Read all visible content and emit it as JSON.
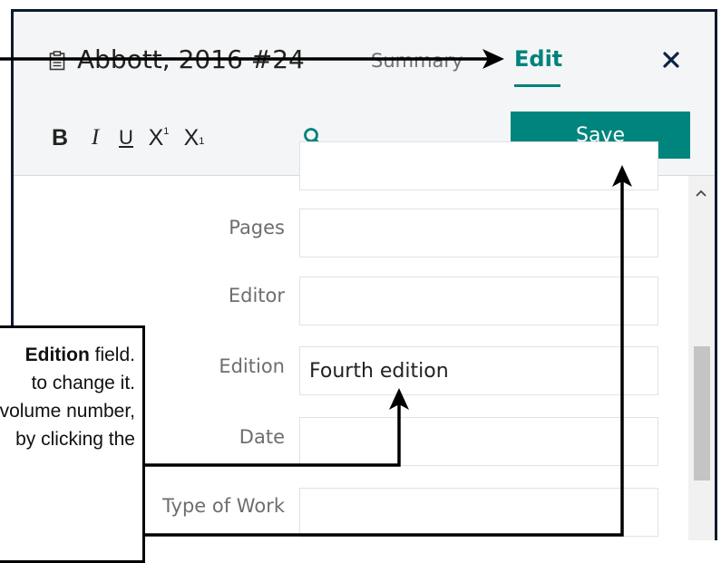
{
  "reference": {
    "icon": "clipboard-icon",
    "title": "Abbott, 2016 #24"
  },
  "tabs": [
    {
      "label": "Summary",
      "active": false
    },
    {
      "label": "Edit",
      "active": true
    }
  ],
  "close_icon": "close-icon",
  "toolbar": {
    "bold_label": "B",
    "italic_label": "I",
    "underline_label": "U",
    "superscript_label": "X",
    "superscript_mark": "1",
    "subscript_label": "X",
    "subscript_mark": "1",
    "search_icon": "search-icon",
    "save_label": "Save"
  },
  "form": {
    "fields": [
      {
        "label": "",
        "value": ""
      },
      {
        "label": "Pages",
        "value": ""
      },
      {
        "label": "Editor",
        "value": ""
      },
      {
        "label": "Edition",
        "value": "Fourth edition"
      },
      {
        "label": "Date",
        "value": ""
      },
      {
        "label": "Type of Work",
        "value": ""
      }
    ]
  },
  "callout": {
    "line1_bold": "Edition",
    "line1_rest": " field.",
    "line2": "to change it.",
    "line3": "volume number,",
    "line4": "",
    "line5": "by clicking the"
  },
  "colors": {
    "accent": "#00827c",
    "save_button": "#00857e",
    "header_bg": "#f4f5f6",
    "panel_border": "#0d1a2e"
  }
}
